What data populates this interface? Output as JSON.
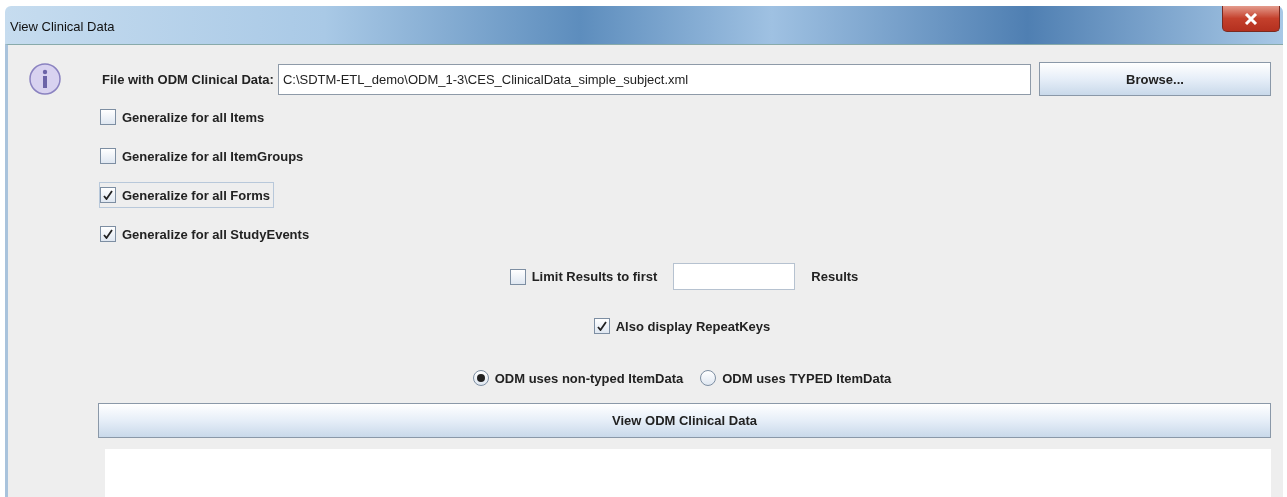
{
  "window": {
    "title": "View Clinical Data"
  },
  "file": {
    "label": "File with ODM Clinical Data:",
    "value": "C:\\SDTM-ETL_demo\\ODM_1-3\\CES_ClinicalData_simple_subject.xml"
  },
  "browse_button": "Browse...",
  "options": [
    {
      "label": "Generalize for all Items",
      "checked": false,
      "focused": false
    },
    {
      "label": "Generalize for all ItemGroups",
      "checked": false,
      "focused": false
    },
    {
      "label": "Generalize for all Forms",
      "checked": true,
      "focused": true
    },
    {
      "label": "Generalize for all StudyEvents",
      "checked": true,
      "focused": false
    }
  ],
  "limit": {
    "label": "Limit Results to first",
    "checked": false,
    "suffix": "Results"
  },
  "repeat_keys": {
    "label": "Also display RepeatKeys",
    "checked": true
  },
  "item_data_modes": [
    {
      "label": "ODM uses non-typed ItemData",
      "selected": true
    },
    {
      "label": "ODM uses TYPED ItemData",
      "selected": false
    }
  ],
  "view_button": "View ODM Clinical Data"
}
